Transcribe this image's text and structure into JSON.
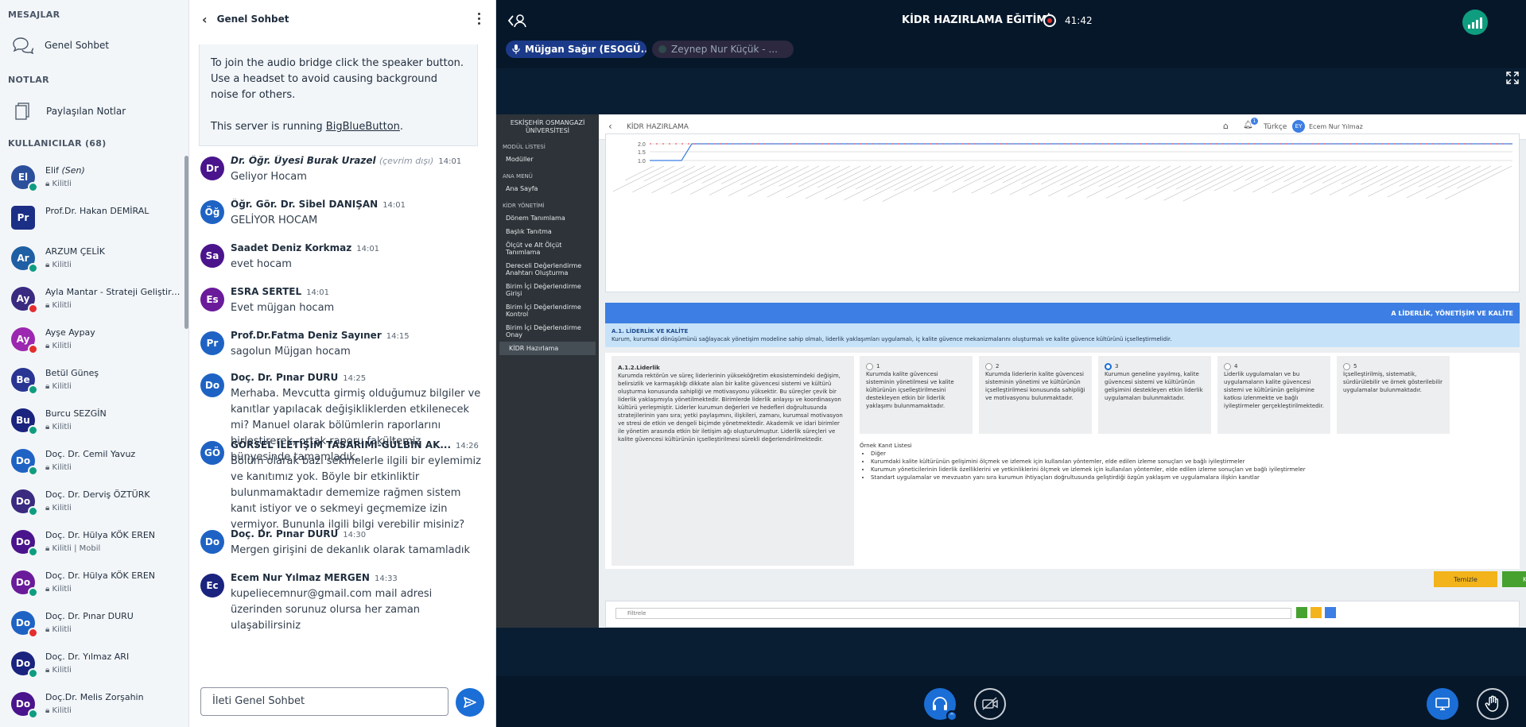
{
  "left": {
    "messages_heading": "MESAJLAR",
    "public_chat": "Genel Sohbet",
    "notes_heading": "NOTLAR",
    "shared_notes": "Paylaşılan Notlar",
    "users_heading": "KULLANICILAR (68)",
    "users": [
      {
        "initials": "El",
        "name": "Elif",
        "you": "(Sen)",
        "status": "Kilitli",
        "color": "#2b4f9b",
        "dot": "#0f9d80",
        "square": false
      },
      {
        "initials": "Pr",
        "name": "Prof.Dr. Hakan DEMİRAL",
        "status": "",
        "color": "#1b2f86",
        "dot": "",
        "square": true
      },
      {
        "initials": "Ar",
        "name": "ARZUM ÇELİK",
        "status": "Kilitli",
        "color": "#1f5fa3",
        "dot": "#0f9d80",
        "square": false
      },
      {
        "initials": "Ay",
        "name": "Ayla Mantar - Strateji Geliştirme D...",
        "status": "Kilitli",
        "color": "#3a2a80",
        "dot": "#e42d2d",
        "square": false
      },
      {
        "initials": "Ay",
        "name": "Ayşe Aypay",
        "status": "Kilitli",
        "color": "#9c27b0",
        "dot": "#e42d2d",
        "square": false
      },
      {
        "initials": "Be",
        "name": "Betül Güneş",
        "status": "Kilitli",
        "color": "#283593",
        "dot": "#0f9d80",
        "square": false
      },
      {
        "initials": "Bu",
        "name": "Burcu SEZGİN",
        "status": "Kilitli",
        "color": "#1a237e",
        "dot": "#0f9d80",
        "square": false
      },
      {
        "initials": "Do",
        "name": "Doç. Dr. Cemil Yavuz",
        "status": "Kilitli",
        "color": "#1e63c4",
        "dot": "#0f9d80",
        "square": false
      },
      {
        "initials": "Do",
        "name": "Doç. Dr. Derviş ÖZTÜRK",
        "status": "Kilitli",
        "color": "#3a2a80",
        "dot": "#0f9d80",
        "square": false
      },
      {
        "initials": "Do",
        "name": "Doç. Dr. Hülya KÖK EREN",
        "status": "Kilitli | Mobil",
        "color": "#4a148c",
        "dot": "#0f9d80",
        "square": false
      },
      {
        "initials": "Do",
        "name": "Doç. Dr. Hülya KÖK EREN",
        "status": "Kilitli",
        "color": "#6a1b9a",
        "dot": "#0f9d80",
        "square": false
      },
      {
        "initials": "Do",
        "name": "Doç. Dr. Pınar DURU",
        "status": "Kilitli",
        "color": "#1e63c4",
        "dot": "#e42d2d",
        "square": false
      },
      {
        "initials": "Do",
        "name": "Doç. Dr. Yılmaz ARI",
        "status": "Kilitli",
        "color": "#1a237e",
        "dot": "#0f9d80",
        "square": false
      },
      {
        "initials": "Do",
        "name": "Doç.Dr. Melis Zorşahin",
        "status": "Kilitli",
        "color": "#4a148c",
        "dot": "#0f9d80",
        "square": false
      }
    ]
  },
  "chat": {
    "title": "Genel Sohbet",
    "welcome1": "To join the audio bridge click the speaker button. Use a headset to avoid causing background noise for others.",
    "welcome2_pre": "This server is running ",
    "welcome2_link": "BigBlueButton",
    "welcome2_post": ".",
    "messages": [
      {
        "initials": "Dr",
        "color": "#4a148c",
        "name": "Dr. Öğr. Üyesi Burak Urazel",
        "offline": "(çevrim dışı)",
        "time": "14:01",
        "text": "Geliyor Hocam",
        "italic": true
      },
      {
        "initials": "Öğ",
        "color": "#1e63c4",
        "name": "Öğr. Gör. Dr. Sibel DANIŞAN",
        "offline": "",
        "time": "14:01",
        "text": "GELİYOR HOCAM",
        "italic": false
      },
      {
        "initials": "Sa",
        "color": "#4a148c",
        "name": "Saadet Deniz Korkmaz",
        "offline": "",
        "time": "14:01",
        "text": "evet hocam",
        "italic": false
      },
      {
        "initials": "Es",
        "color": "#6a1b9a",
        "name": "ESRA SERTEL",
        "offline": "",
        "time": "14:01",
        "text": "Evet müjgan hocam",
        "italic": false
      },
      {
        "initials": "Pr",
        "color": "#1e63c4",
        "name": "Prof.Dr.Fatma Deniz Sayıner",
        "offline": "",
        "time": "14:15",
        "text": "sagolun Müjgan hocam",
        "italic": false
      },
      {
        "initials": "Do",
        "color": "#1e63c4",
        "name": "Doç. Dr. Pınar DURU",
        "offline": "",
        "time": "14:25",
        "text": "Merhaba. Mevcutta girmiş olduğumuz bilgiler ve kanıtlar yapılacak değişikliklerden etkilenecek mi? Manuel olarak bölümlerin raporlarını birleştirerek, ortak raporu fakültemiz bünyesinde tamamladık.",
        "italic": false
      },
      {
        "initials": "GÖ",
        "color": "#1e63c4",
        "name": "GÖRSEL İLETİŞİM TASARIMI-GÜLBİN AK...",
        "offline": "",
        "time": "14:26",
        "text": "Bölüm olarak bazı sekmelerle ilgili bir eylemimiz ve kanıtımız yok. Böyle bir etkinliktir bulunmamaktadır dememize rağmen sistem kanıt istiyor ve o sekmeyi geçmemize izin vermiyor. Bununla ilgili bilgi verebilir misiniz?",
        "italic": false
      },
      {
        "initials": "Do",
        "color": "#1e63c4",
        "name": "Doç. Dr. Pınar DURU",
        "offline": "",
        "time": "14:30",
        "text": "Mergen girişini de dekanlık olarak tamamladık",
        "italic": false
      },
      {
        "initials": "Ec",
        "color": "#1a237e",
        "name": "Ecem Nur Yılmaz MERGEN",
        "offline": "",
        "time": "14:33",
        "text": "kupeliecemnur@gmail.com mail adresi üzerinden sorunuz olursa her zaman ulaşabilirsiniz",
        "italic": false
      }
    ],
    "input_placeholder": "İleti Genel Sohbet"
  },
  "meeting": {
    "title": "KİDR HAZIRLAMA EĞITİMİ",
    "record_time": "41:42",
    "talker1": "Müjgan Sağır (ESOGÜ...",
    "talker2": "Zeynep Nur Küçük - ..."
  },
  "share": {
    "university": "ESKİŞEHİR OSMANGAZİ ÜNİVERSİTESİ",
    "sidebar": [
      {
        "label": "MODÜL LİSTESİ",
        "type": "sec"
      },
      {
        "label": "Modüller",
        "type": "item"
      },
      {
        "label": "ANA MENÜ",
        "type": "sec"
      },
      {
        "label": "Ana Sayfa",
        "type": "item"
      },
      {
        "label": "KİDR YÖNETİMİ",
        "type": "sec"
      },
      {
        "label": "Dönem Tanımlama",
        "type": "item"
      },
      {
        "label": "Başlık Tanıtma",
        "type": "item"
      },
      {
        "label": "Ölçüt ve Alt Ölçüt Tanımlama",
        "type": "item"
      },
      {
        "label": "Dereceli Değerlendirme Anahtarı Oluşturma",
        "type": "item"
      },
      {
        "label": "Birim İçi Değerlendirme Girişi",
        "type": "item"
      },
      {
        "label": "Birim İçi Değerlendirme Kontrol",
        "type": "item"
      },
      {
        "label": "Birim İçi Değerlendirme Onay",
        "type": "item"
      },
      {
        "label": "KİDR Hazırlama",
        "type": "active"
      }
    ],
    "page_title": "KİDR HAZIRLAMA",
    "language": "Türkçe",
    "user_initials": "EY",
    "user_name": "Ecem Nur Yılmaz",
    "notif_count": "1",
    "chart_y_ticks": [
      "2.0",
      "1.5",
      "1.0"
    ],
    "section_band": "A LİDERLİK, YÖNETİŞİM VE KALİTE",
    "subsection_title": "A.1. LİDERLİK VE KALİTE",
    "subsection_desc": "Kurum, kurumsal dönüşümünü sağlayacak yönetişim modeline sahip olmalı, liderlik yaklaşımları uygulamalı, iç kalite güvence mekanizmalarını oluşturmalı ve kalite güvence kültürünü içselleştirmelidir.",
    "criterion_title": "A.1.2.Liderlik",
    "criterion_text": "Kurumda rektörün ve süreç liderlerinin yükseköğretim ekosistemindeki değişim, belirsizlik ve karmaşıklığı dikkate alan bir kalite güvencesi sistemi ve kültürü oluşturma konusunda sahipliği ve motivasyonu yüksektir. Bu süreçler çevik bir liderlik yaklaşımıyla yönetilmektedir. Birimlerde liderlik anlayışı ve koordinasyon kültürü yerleşmiştir. Liderler kurumun değerleri ve hedefleri doğrultusunda stratejilerinin yanı sıra; yetki paylaşımını, ilişkileri, zamanı, kurumsal motivasyon ve stresi de etkin ve dengeli biçimde yönetmektedir. Akademik ve idari birimler ile yönetim arasında etkin bir iletişim ağı oluşturulmuştur. Liderlik süreçleri ve kalite güvencesi kültürünün içselleştirilmesi sürekli değerlendirilmektedir.",
    "levels": [
      {
        "n": "1",
        "t": "Kurumda kalite güvencesi sisteminin yönetilmesi ve kalite kültürünün içselleştirilmesini destekleyen etkin bir liderlik yaklaşımı bulunmamaktadır."
      },
      {
        "n": "2",
        "t": "Kurumda liderlerin kalite güvencesi sisteminin yönetimi ve kültürünün içselleştirilmesi konusunda sahipliği ve motivasyonu bulunmaktadır."
      },
      {
        "n": "3",
        "t": "Kurumun geneline yayılmış, kalite güvencesi sistemi ve kültürünün gelişimini destekleyen etkin liderlik uygulamaları bulunmaktadır."
      },
      {
        "n": "4",
        "t": "Liderlik uygulamaları ve bu uygulamaların kalite güvencesi sistemi ve kültürünün gelişimine katkısı izlenmekte ve bağlı iyileştirmeler gerçekleştirilmektedir."
      },
      {
        "n": "5",
        "t": "İçselleştirilmiş, sistematik, sürdürülebilir ve örnek gösterilebilir uygulamalar bulunmaktadır."
      }
    ],
    "evidence_title": "Örnek Kanıt Listesi",
    "evidence": [
      "Diğer",
      "Kurumdaki kalite kültürünün gelişimini ölçmek ve izlemek için kullanılan yöntemler, elde edilen izleme sonuçları ve bağlı iyileştirmeler",
      "Kurumun yöneticilerinin liderlik özelliklerini ve yetkinliklerini ölçmek ve izlemek için kullanılan yöntemler, elde edilen izleme sonuçları ve bağlı iyileştirmeler",
      "Standart uygulamalar ve mevzuatın yanı sıra kurumun ihtiyaçları doğrultusunda geliştirdiği özgün yaklaşım ve uygulamalara ilişkin kanıtlar"
    ],
    "btn_clear": "Temizle",
    "btn_save": "Kaydet",
    "filter_placeholder": "Filtrele"
  }
}
